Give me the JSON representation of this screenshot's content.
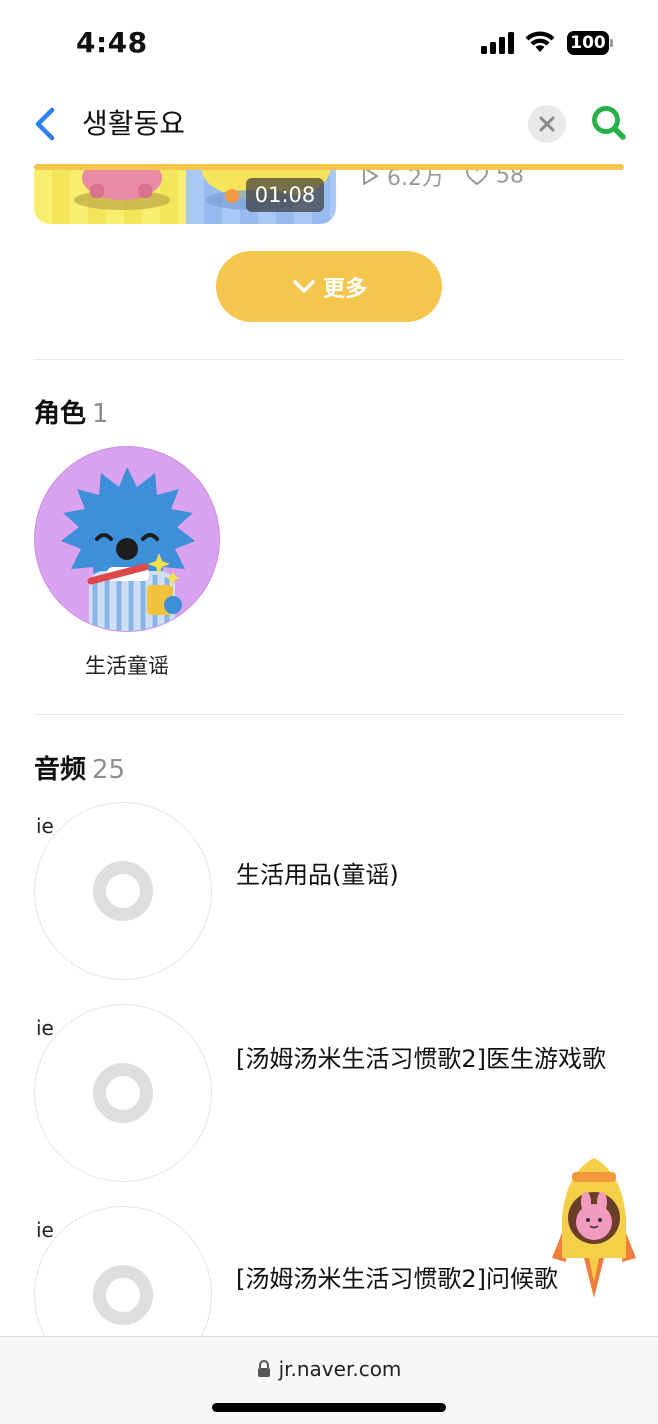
{
  "status_bar": {
    "time": "4:48",
    "battery": "100"
  },
  "search": {
    "query": "생활동요",
    "icons": {
      "back": "chevron-left-icon",
      "clear": "close-icon",
      "search": "search-icon"
    },
    "colors": {
      "back": "#2f80ed",
      "search": "#27b04a",
      "accent": "#f4c64d"
    }
  },
  "video": {
    "duration": "01:08",
    "plays": "6.2万",
    "likes": "58"
  },
  "more_button": {
    "label": "更多"
  },
  "characters": {
    "title": "角色",
    "count": "1",
    "items": [
      {
        "name": "生活童谣"
      }
    ]
  },
  "audio": {
    "title": "音频",
    "count": "25",
    "items": [
      {
        "disc_label": "ie",
        "title": "生活用品(童谣)"
      },
      {
        "disc_label": "ie",
        "title": "[汤姆汤米生活习惯歌2]医生游戏歌"
      },
      {
        "disc_label": "ie",
        "title": "[汤姆汤米生活习惯歌2]问候歌"
      }
    ]
  },
  "url_bar": {
    "domain": "jr.naver.com"
  }
}
